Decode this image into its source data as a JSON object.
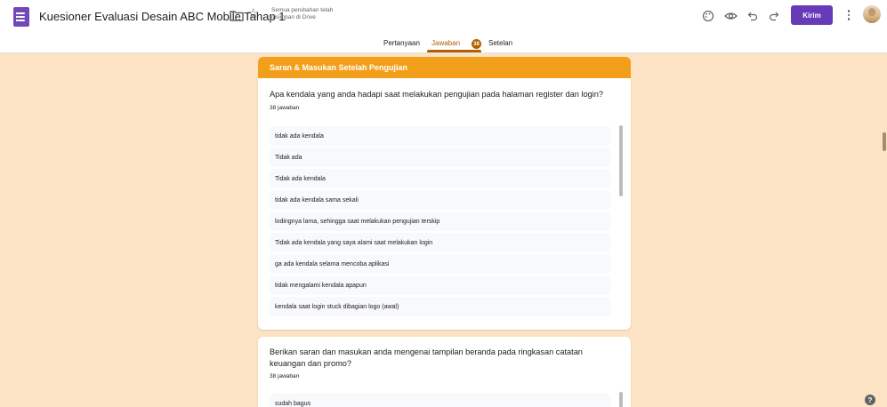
{
  "header": {
    "title": "Kuesioner Evaluasi Desain ABC Mobile Tahap 1",
    "save_status": "Semua perubahan telah disimpan di Drive",
    "send_label": "Kirim",
    "icons": [
      "forms-app-icon",
      "folder-icon",
      "star-icon",
      "palette-icon",
      "preview-icon",
      "undo-icon",
      "redo-icon",
      "more-icon",
      "avatar"
    ]
  },
  "tabs": [
    {
      "label": "Pertanyaan",
      "active": false
    },
    {
      "label": "Jawaban",
      "active": true,
      "count": "38"
    },
    {
      "label": "Setelan",
      "active": false
    }
  ],
  "section": {
    "title": "Saran & Masukan Setelah Pengujian",
    "color": "#f29f1b"
  },
  "questions": [
    {
      "title": "Apa kendala yang anda hadapi saat melakukan pengujian pada halaman register dan login?",
      "count": "38 jawaban",
      "answers": [
        "tidak ada kendala",
        "Tidak ada",
        "Tidak ada kendala",
        "tidak ada kendala sama sekali",
        "lodingnya lama, sehingga saat melakukan pengujian terskip",
        "Tidak ada kendala yang saya alami saat melakukan login",
        "ga ada kendala selama mencoba aplikasi",
        "tidak mengalami kendala apapun",
        "kendala saat login stuck dibagian logo (awal)"
      ]
    },
    {
      "title": "Berikan saran dan masukan anda mengenai tampilan beranda pada ringkasan catatan keuangan dan promo?",
      "count": "38 jawaban",
      "answers": [
        "sudah bagus"
      ]
    }
  ],
  "colors": {
    "background": "#fbe3c4",
    "accent": "#b06000",
    "send_button": "#673ab7"
  }
}
